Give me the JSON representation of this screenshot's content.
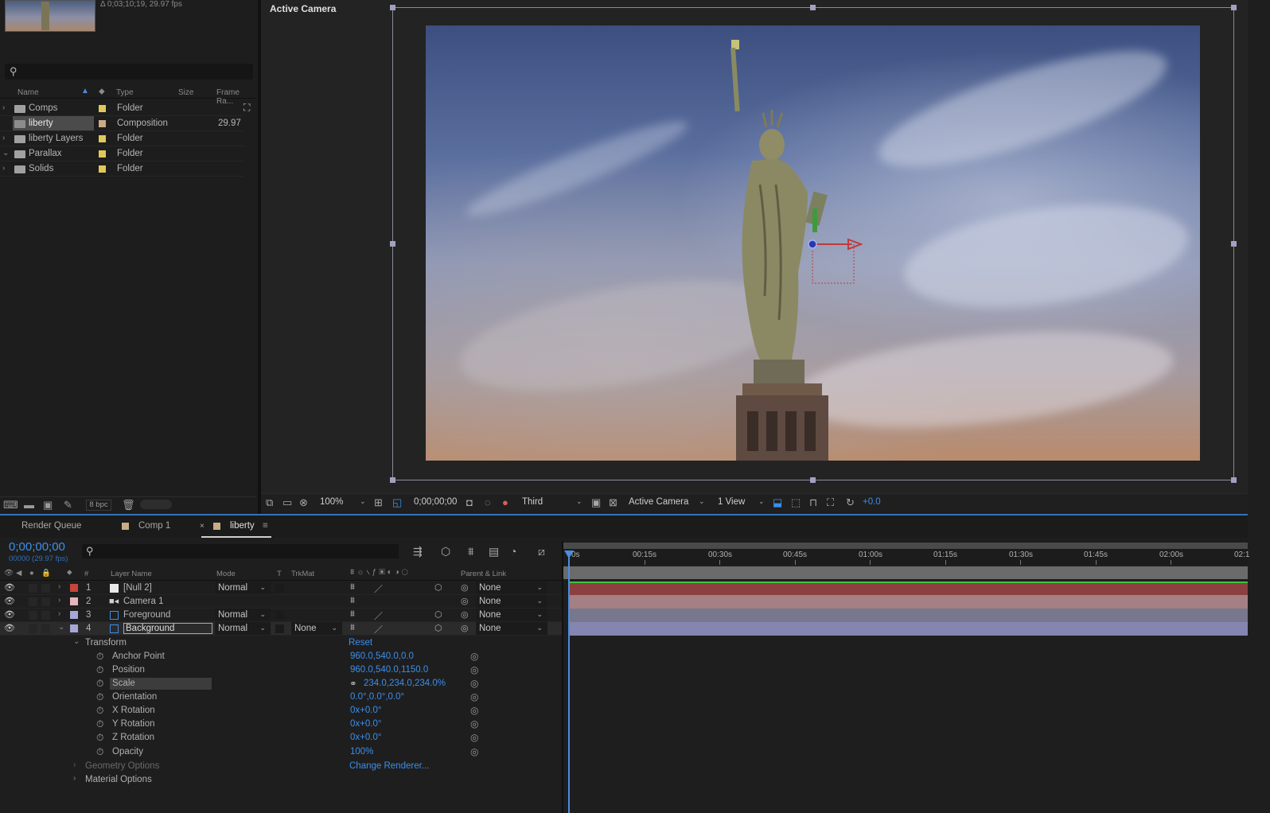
{
  "project": {
    "info": "Δ 0;03;10;19, 29.97 fps",
    "columns": {
      "name": "Name",
      "type": "Type",
      "size": "Size",
      "frame_rate": "Frame Ra..."
    },
    "items": [
      {
        "name": "Comps",
        "type": "Folder",
        "frame_rate": "",
        "color": "#e0c95a",
        "expanded": false
      },
      {
        "name": "liberty",
        "type": "Composition",
        "frame_rate": "29.97",
        "color": "#c9ab86",
        "selected": true
      },
      {
        "name": "liberty Layers",
        "type": "Folder",
        "frame_rate": "",
        "color": "#e0c95a",
        "expanded": false
      },
      {
        "name": "Parallax",
        "type": "Folder",
        "frame_rate": "",
        "color": "#e0c95a",
        "expanded": true
      },
      {
        "name": "Solids",
        "type": "Folder",
        "frame_rate": "",
        "color": "#e0c95a",
        "expanded": false
      }
    ],
    "bpc": "8 bpc"
  },
  "viewer": {
    "title": "Active Camera",
    "toolbar": {
      "zoom": "100%",
      "timecode": "0;00;00;00",
      "resolution": "Third",
      "camera": "Active Camera",
      "views": "1 View",
      "exposure": "+0.0"
    }
  },
  "timeline": {
    "tabs": {
      "render_queue": "Render Queue",
      "comp1": "Comp 1",
      "liberty": "liberty"
    },
    "timecode": "0;00;00;00",
    "fps": "00000 (29.97 fps)",
    "columns": {
      "num": "#",
      "layer_name": "Layer Name",
      "mode": "Mode",
      "t": "T",
      "trkmat": "TrkMat",
      "parent": "Parent & Link"
    },
    "layers": [
      {
        "num": "1",
        "name": "[Null 2]",
        "mode": "Normal",
        "trkmat": "",
        "parent": "None",
        "label": "#c8443c"
      },
      {
        "num": "2",
        "name": "Camera 1",
        "mode": "",
        "trkmat": "",
        "parent": "None",
        "label": "#e7b5bd"
      },
      {
        "num": "3",
        "name": "Foreground",
        "mode": "Normal",
        "trkmat": "",
        "parent": "None",
        "label": "#a6a6d8"
      },
      {
        "num": "4",
        "name": "Background",
        "mode": "Normal",
        "trkmat": "None",
        "parent": "None",
        "label": "#a6a6d8"
      }
    ],
    "transform": {
      "label": "Transform",
      "reset": "Reset",
      "properties": [
        {
          "name": "Anchor Point",
          "value": "960.0,540.0,0.0"
        },
        {
          "name": "Position",
          "value": "960.0,540.0,1150.0"
        },
        {
          "name": "Scale",
          "value": "234.0,234.0,234.0%"
        },
        {
          "name": "Orientation",
          "value": "0.0°,0.0°,0.0°"
        },
        {
          "name": "X Rotation",
          "value": "0x+0.0°"
        },
        {
          "name": "Y Rotation",
          "value": "0x+0.0°"
        },
        {
          "name": "Z Rotation",
          "value": "0x+0.0°"
        },
        {
          "name": "Opacity",
          "value": "100%"
        }
      ]
    },
    "geometry_options": "Geometry Options",
    "change_renderer": "Change Renderer...",
    "material_options": "Material Options",
    "ruler": [
      "0s",
      "00:15s",
      "00:30s",
      "00:45s",
      "01:00s",
      "01:15s",
      "01:30s",
      "01:45s",
      "02:00s",
      "02:1"
    ],
    "bar_colors": [
      "#8c3f3f",
      "#a47f83",
      "#77778e",
      "#8585b1"
    ],
    "null_line_color": "#3ec43e"
  }
}
